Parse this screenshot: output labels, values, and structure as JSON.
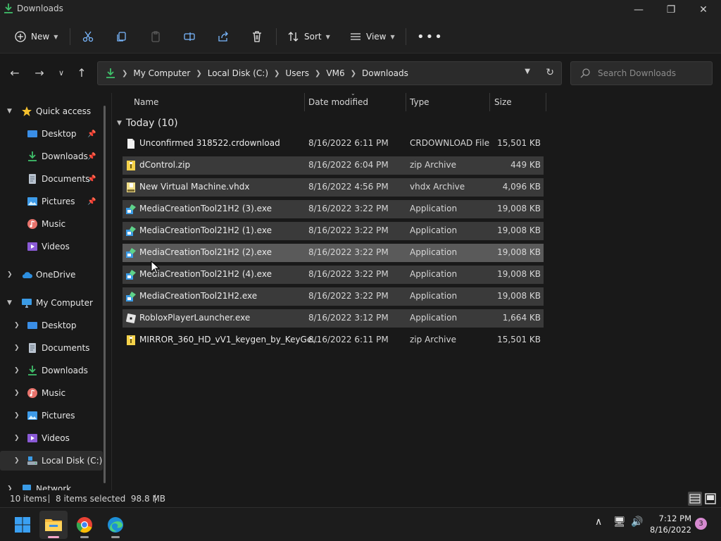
{
  "window": {
    "title": "Downloads"
  },
  "toolbar": {
    "new_label": "New",
    "sort_label": "Sort",
    "view_label": "View"
  },
  "address": {
    "crumbs": [
      "My Computer",
      "Local Disk (C:)",
      "Users",
      "VM6",
      "Downloads"
    ]
  },
  "search": {
    "placeholder": "Search Downloads"
  },
  "nav": {
    "quick_access": "Quick access",
    "quick_items": [
      "Desktop",
      "Downloads",
      "Documents",
      "Pictures",
      "Music",
      "Videos"
    ],
    "onedrive": "OneDrive",
    "my_computer": "My Computer",
    "computer_items": [
      "Desktop",
      "Documents",
      "Downloads",
      "Music",
      "Pictures",
      "Videos",
      "Local Disk (C:)"
    ],
    "network": "Network"
  },
  "columns": {
    "name": "Name",
    "date": "Date modified",
    "type": "Type",
    "size": "Size"
  },
  "group": {
    "label": "Today (10)"
  },
  "files": [
    {
      "name": "Unconfirmed 318522.crdownload",
      "date": "8/16/2022 6:11 PM",
      "type": "CRDOWNLOAD File",
      "size": "15,501 KB",
      "icon": "blank-file-icon",
      "selected": false
    },
    {
      "name": "dControl.zip",
      "date": "8/16/2022 6:04 PM",
      "type": "zip Archive",
      "size": "449 KB",
      "icon": "zip-icon",
      "selected": true
    },
    {
      "name": "New Virtual Machine.vhdx",
      "date": "8/16/2022 4:56 PM",
      "type": "vhdx Archive",
      "size": "4,096 KB",
      "icon": "vhdx-icon",
      "selected": true
    },
    {
      "name": "MediaCreationTool21H2 (3).exe",
      "date": "8/16/2022 3:22 PM",
      "type": "Application",
      "size": "19,008 KB",
      "icon": "setup-app-icon",
      "selected": true
    },
    {
      "name": "MediaCreationTool21H2 (1).exe",
      "date": "8/16/2022 3:22 PM",
      "type": "Application",
      "size": "19,008 KB",
      "icon": "setup-app-icon",
      "selected": true
    },
    {
      "name": "MediaCreationTool21H2 (2).exe",
      "date": "8/16/2022 3:22 PM",
      "type": "Application",
      "size": "19,008 KB",
      "icon": "setup-app-icon",
      "selected": true,
      "focused": true
    },
    {
      "name": "MediaCreationTool21H2 (4).exe",
      "date": "8/16/2022 3:22 PM",
      "type": "Application",
      "size": "19,008 KB",
      "icon": "setup-app-icon",
      "selected": true
    },
    {
      "name": "MediaCreationTool21H2.exe",
      "date": "8/16/2022 3:22 PM",
      "type": "Application",
      "size": "19,008 KB",
      "icon": "setup-app-icon",
      "selected": true
    },
    {
      "name": "RobloxPlayerLauncher.exe",
      "date": "8/16/2022 3:12 PM",
      "type": "Application",
      "size": "1,664 KB",
      "icon": "roblox-icon",
      "selected": true
    },
    {
      "name": "MIRROR_360_HD_vV1_keygen_by_KeyGe...",
      "date": "8/16/2022 6:11 PM",
      "type": "zip Archive",
      "size": "15,501 KB",
      "icon": "zip-icon",
      "selected": false
    }
  ],
  "status": {
    "count": "10 items",
    "selection": "8 items selected  98.8 MB"
  },
  "clock": {
    "time": "7:12 PM",
    "date": "8/16/2022"
  },
  "notifications": {
    "count": "3"
  },
  "colors": {
    "accent": "#0078d4",
    "selected_row": "#3a3a3a",
    "focused_row": "#5a5a5a"
  }
}
